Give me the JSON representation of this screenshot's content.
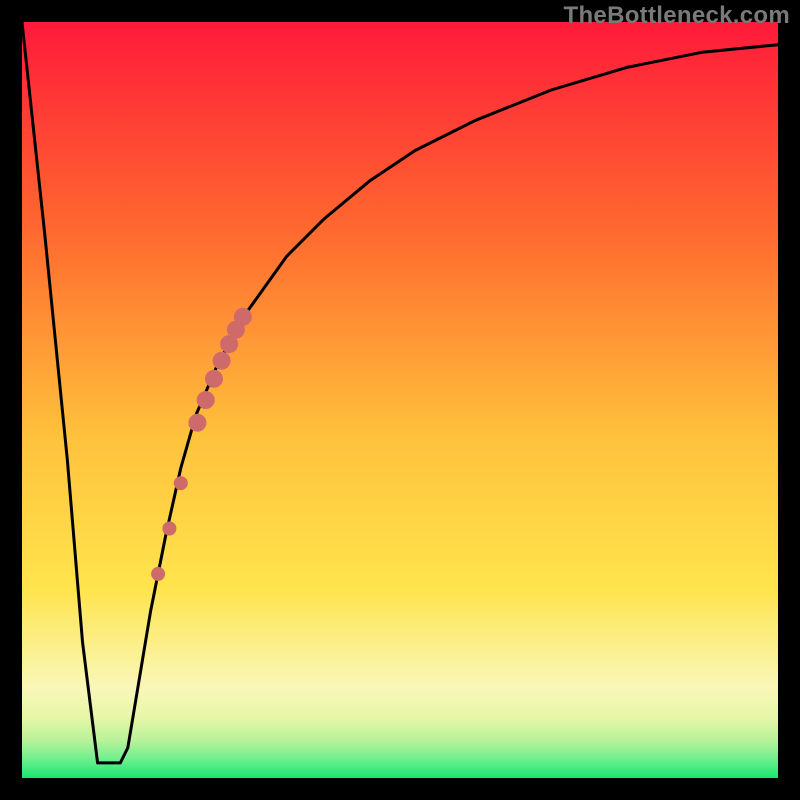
{
  "watermark": "TheBottleneck.com",
  "colors": {
    "frame": "#000000",
    "curve": "#000000",
    "marker": "#cf6a6a",
    "gradient_top": "#ff1a3a",
    "gradient_mid1": "#ff8a2a",
    "gradient_mid2": "#ffe44d",
    "gradient_pale": "#f8f9c8",
    "gradient_bottom": "#18e66e"
  },
  "chart_data": {
    "type": "line",
    "title": "",
    "xlabel": "",
    "ylabel": "",
    "xlim": [
      0,
      100
    ],
    "ylim": [
      0,
      100
    ],
    "series": [
      {
        "name": "bottleneck-curve",
        "x": [
          0,
          3,
          6,
          8,
          10,
          11,
          12,
          13,
          14,
          15,
          17,
          19,
          21,
          23,
          26,
          30,
          35,
          40,
          46,
          52,
          60,
          70,
          80,
          90,
          100
        ],
        "y": [
          100,
          72,
          42,
          18,
          2,
          2,
          2,
          2,
          4,
          10,
          22,
          32,
          41,
          48,
          55,
          62,
          69,
          74,
          79,
          83,
          87,
          91,
          94,
          96,
          97
        ]
      }
    ],
    "markers": {
      "name": "highlighted-segment",
      "points": [
        {
          "x": 18.0,
          "y": 27.0,
          "r": 7
        },
        {
          "x": 19.5,
          "y": 33.0,
          "r": 7
        },
        {
          "x": 21.0,
          "y": 39.0,
          "r": 7
        },
        {
          "x": 23.2,
          "y": 47.0,
          "r": 9
        },
        {
          "x": 24.3,
          "y": 50.0,
          "r": 9
        },
        {
          "x": 25.4,
          "y": 52.8,
          "r": 9
        },
        {
          "x": 26.4,
          "y": 55.2,
          "r": 9
        },
        {
          "x": 27.4,
          "y": 57.4,
          "r": 9
        },
        {
          "x": 28.3,
          "y": 59.3,
          "r": 9
        },
        {
          "x": 29.2,
          "y": 61.0,
          "r": 9
        }
      ]
    }
  }
}
